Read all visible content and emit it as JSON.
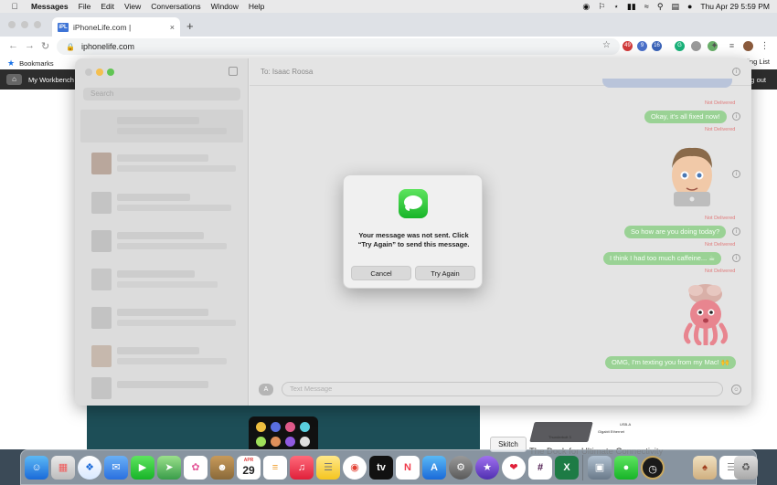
{
  "menubar": {
    "apple": "",
    "app": "Messages",
    "items": [
      "File",
      "Edit",
      "View",
      "Conversations",
      "Window",
      "Help"
    ],
    "clock": "Thu Apr 29  5:59 PM"
  },
  "browser": {
    "tab_title": "iPhoneLife.com |",
    "tab_favicon": "iPL",
    "url": "iphonelife.com",
    "bookmarks_label": "Bookmarks",
    "reading_list": "Reading List",
    "ext_badges": [
      "49",
      "9",
      "16"
    ]
  },
  "site": {
    "workbench": "My Workbench",
    "logout": "Log out",
    "skitch": "Skitch",
    "dock_caption": "The Dock for Ultimate Connectivity",
    "dock_labels": [
      "Thunderbolt 3",
      "Gigabit Ethernet",
      "USB-A"
    ]
  },
  "messages": {
    "search_placeholder": "Search",
    "to_label": "To:  Isaac Roosa",
    "not_delivered": "Not Delivered",
    "bubbles": [
      "Okay, it's all fixed now!",
      "So how are you doing today?",
      "I think I had too much caffeine... ☕",
      "OMG, I'm texting you from my Mac! 🙌"
    ],
    "input_placeholder": "Text Message"
  },
  "alert": {
    "message": "Your message was not sent. Click “Try Again” to send this message.",
    "cancel": "Cancel",
    "try_again": "Try Again"
  },
  "dock": {
    "calendar_month": "APR",
    "calendar_day": "29"
  },
  "colors": {
    "imessage_green": "#9ad295",
    "alert_bg": "#f0f0f0",
    "not_delivered": "#e07a7a"
  }
}
